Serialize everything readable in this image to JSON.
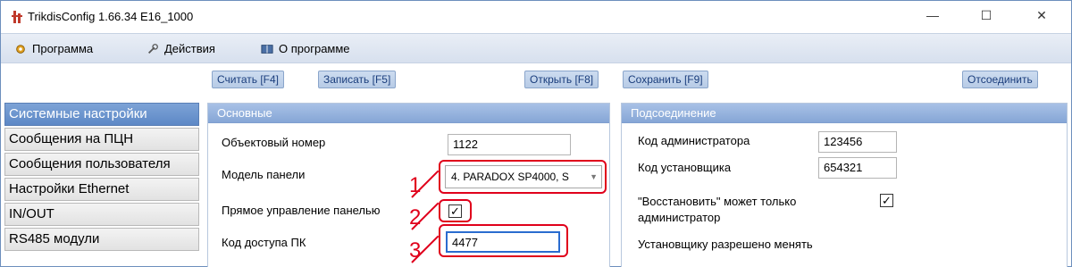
{
  "window": {
    "title": "TrikdisConfig 1.66.34   E16_1000",
    "minimize": "—",
    "maximize": "☐",
    "close": "✕"
  },
  "menu": {
    "program": "Программа",
    "actions": "Действия",
    "about": "О программе"
  },
  "toolbar": {
    "read": "Считать [F4]",
    "write": "Записать [F5]",
    "open": "Открыть [F8]",
    "save": "Сохранить [F9]",
    "disconnect": "Отсоединить"
  },
  "sidebar": {
    "items": [
      {
        "label": "Системные настройки"
      },
      {
        "label": "Сообщения на ПЦН"
      },
      {
        "label": "Сообщения пользователя"
      },
      {
        "label": "Настройки Ethernet"
      },
      {
        "label": "IN/OUT"
      },
      {
        "label": "RS485 модули"
      }
    ]
  },
  "main_panel": {
    "header": "Основные",
    "object_number_label": "Объектовый номер",
    "object_number_value": "1122",
    "panel_model_label": "Модель панели",
    "panel_model_value": "4. PARADOX SP4000, S",
    "direct_control_label": "Прямое управление панелью",
    "direct_control_checked": true,
    "pc_code_label": "Код доступа ПК",
    "pc_code_value": "4477"
  },
  "connection_panel": {
    "header": "Подсоединение",
    "admin_code_label": "Код администратора",
    "admin_code_value": "123456",
    "installer_code_label": "Код установщика",
    "installer_code_value": "654321",
    "restore_label_1": "\"Восстановить\" может только",
    "restore_label_2": "администратор",
    "restore_checked": true,
    "installer_allowed_label": "Установщику разрешено менять"
  },
  "callouts": {
    "one": "1",
    "two": "2",
    "three": "3"
  },
  "colors": {
    "callout": "#e0001b",
    "accent": "#5d88c6"
  }
}
